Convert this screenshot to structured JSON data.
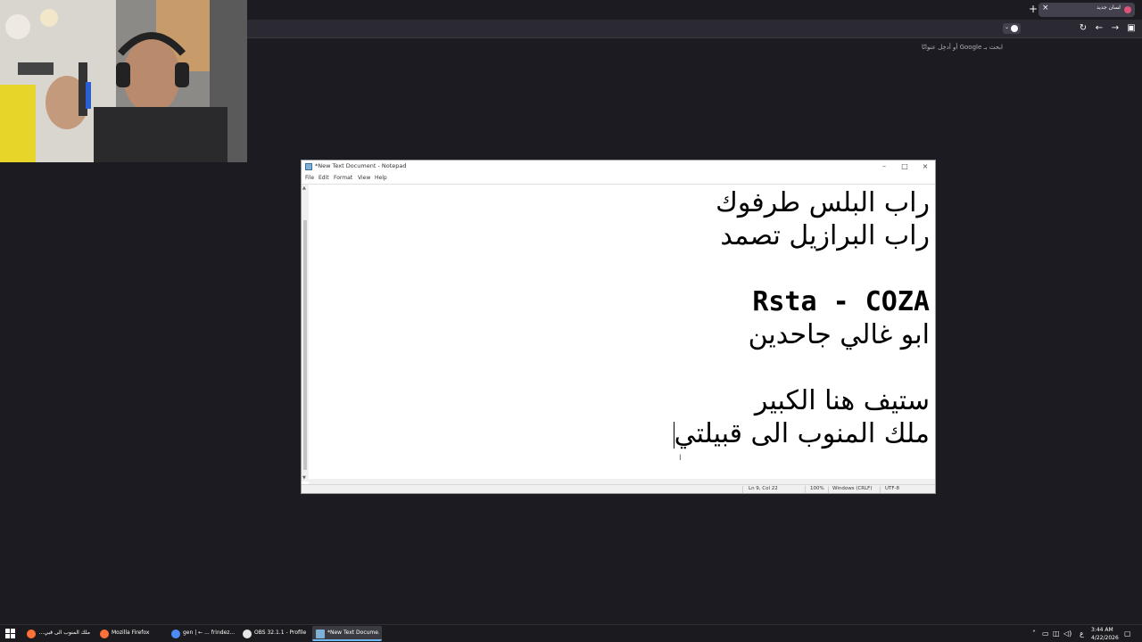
{
  "browser": {
    "tab": {
      "title": "لسان جديد"
    },
    "urlbar": {
      "placeholder": "ابحث بـ Google أو أدخِل عنوانًا"
    },
    "colors": {
      "frame": "#1c1b22",
      "toolbar": "#2b2a33",
      "tab_active": "#42414d"
    }
  },
  "notepad": {
    "title": "*New Text Document - Notepad",
    "menu": [
      "File",
      "Edit",
      "Format",
      "View",
      "Help"
    ],
    "lines": [
      "راب البلس طرفوك",
      "راب البرازيل تصمد",
      "",
      "Rsta - COZA",
      "ابو غالي جاحدين",
      "",
      "ستيف هنا الكبير",
      "ملك المنوب الى قبيلتي"
    ],
    "status": {
      "position": "Ln 9, Col 22",
      "zoom": "100%",
      "line_ending": "Windows (CRLF)",
      "encoding": "UTF-8"
    }
  },
  "taskbar": {
    "tasks": [
      {
        "label": "ملك المنوب الى قبي...",
        "icon": "firefox-icon",
        "color": "#ff7139"
      },
      {
        "label": "Mozilla Firefox",
        "icon": "firefox-icon",
        "color": "#ff7139"
      },
      {
        "label": "gen | ← ... frindez...",
        "icon": "chrome-icon",
        "color": "#4c8bf5"
      },
      {
        "label": "OBS 32.1.1 - Profile...",
        "icon": "obs-icon",
        "color": "#e6e6e6"
      },
      {
        "label": "*New Text Docume...",
        "icon": "notepad-icon",
        "color": "#7fb0d8"
      }
    ],
    "tray_lang": "ع",
    "time": "3:44 AM",
    "date": "4/22/2026"
  }
}
